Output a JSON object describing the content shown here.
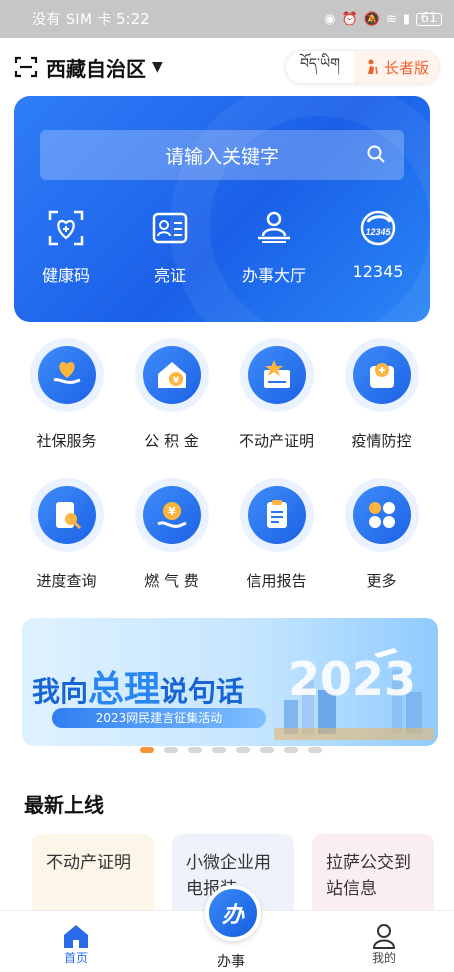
{
  "status_bar": {
    "carrier": "没有 SIM 卡",
    "time": "5:22",
    "battery": "61"
  },
  "top_bar": {
    "region": "西藏自治区",
    "lang_label": "བོད་ཡིག",
    "elder_mode": "长者版"
  },
  "hero": {
    "search_placeholder": "请输入关键字",
    "quick": [
      {
        "label": "健康码",
        "icon": "health-code-icon"
      },
      {
        "label": "亮证",
        "icon": "id-card-icon"
      },
      {
        "label": "办事大厅",
        "icon": "service-hall-icon"
      },
      {
        "label": "12345",
        "icon": "hotline-icon"
      }
    ]
  },
  "services": [
    {
      "label": "社保服务",
      "icon": "social-security-icon"
    },
    {
      "label": "公 积 金",
      "icon": "housing-fund-icon"
    },
    {
      "label": "不动产证明",
      "icon": "real-estate-icon"
    },
    {
      "label": "疫情防控",
      "icon": "epidemic-icon"
    },
    {
      "label": "进度查询",
      "icon": "progress-query-icon"
    },
    {
      "label": "燃 气 费",
      "icon": "gas-fee-icon"
    },
    {
      "label": "信用报告",
      "icon": "credit-report-icon"
    },
    {
      "label": "更多",
      "icon": "more-icon"
    }
  ],
  "banner": {
    "line_a": "我向",
    "line_b": "总理",
    "line_c": "说句话",
    "subtitle": "2023网民建言征集活动",
    "year": "2023"
  },
  "latest": {
    "title": "最新上线",
    "cards": [
      {
        "text": "不动产证明",
        "bg": "#fcf6e8"
      },
      {
        "text": "小微企业用电报装",
        "bg": "#eef3fb"
      },
      {
        "text": "拉萨公交到站信息",
        "bg": "#fbeef0"
      }
    ]
  },
  "bottom_nav": {
    "home": "首页",
    "center": "办事",
    "center_glyph": "办",
    "me": "我的"
  },
  "colors": {
    "accent": "#1f6ae8",
    "elder": "#f0622d",
    "dot_active": "#f5943a"
  }
}
